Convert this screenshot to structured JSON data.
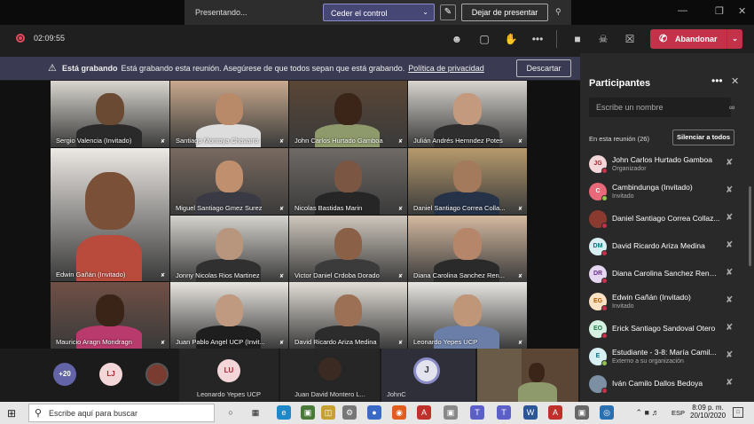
{
  "sharing_bar": {
    "status": "Presentando...",
    "give_control": "Ceder el control",
    "stop_presenting": "Dejar de presentar"
  },
  "meeting": {
    "timer": "02:09:55",
    "leave_label": "Abandonar"
  },
  "banner": {
    "title": "Está grabando",
    "message": "Está grabando esta reunión. Asegúrese de que todos sepan que está grabando.",
    "link": "Política de privacidad",
    "dismiss": "Descartar"
  },
  "tiles": [
    {
      "name": "Sergio Valencia (Invitado)",
      "bg": "#d9d6cf",
      "skin": "#6b4a33",
      "shirt": "#2a2a2a"
    },
    {
      "name": "Santiago Montoya Chavarro",
      "bg": "#c9a98e",
      "skin": "#b98a6a",
      "shirt": "#dddddd"
    },
    {
      "name": "John Carlos Hurtado Gamboa",
      "bg": "#5a4636",
      "skin": "#3b2418",
      "shirt": "#8e9a6b"
    },
    {
      "name": "Julián Andrés Hernndez Potes",
      "bg": "#d8d4cf",
      "skin": "#c49a7e",
      "shirt": "#2e2e2e"
    },
    {
      "name": "Edwin Gañán (Invitado)",
      "bg": "#ece8e4",
      "skin": "#7a5138",
      "shirt": "#b84b3b"
    },
    {
      "name": "Miguel Santiago Gmez Surez",
      "bg": "#7a6a60",
      "skin": "#c0906e",
      "shirt": "#3a3a44"
    },
    {
      "name": "Nicolas Bastidas Marin",
      "bg": "#6f6a66",
      "skin": "#7b5743",
      "shirt": "#262626"
    },
    {
      "name": "Daniel Santiago Correa Colla...",
      "bg": "#b79a6c",
      "skin": "#a37a5c",
      "shirt": "#263248"
    },
    {
      "name": "Jonny Nicolas Rios Martinez",
      "bg": "#d5d3cd",
      "skin": "#b8957d",
      "shirt": "#303030"
    },
    {
      "name": "Victor Daniel Crdoba Dorado",
      "bg": "#cfc7bd",
      "skin": "#8a6047",
      "shirt": "#3b3b3b"
    },
    {
      "name": "Diana Carolina Sanchez Ren...",
      "bg": "#d4b9a0",
      "skin": "#b5866a",
      "shirt": "#2a2a2a"
    },
    {
      "name": "Mauricio Aragn Mondragn",
      "bg": "#705046",
      "skin": "#3a2418",
      "shirt": "#b93a6c"
    },
    {
      "name": "Juan Pablo Angel UCP (Invit...",
      "bg": "#e8e5e0",
      "skin": "#c09a80",
      "shirt": "#1e1e1e"
    },
    {
      "name": "David Ricardo Ariza Medina",
      "bg": "#e2ddd6",
      "skin": "#9b7054",
      "shirt": "#2c2c2c"
    },
    {
      "name": "Leonardo Yepes UCP",
      "bg": "#e8e6e2",
      "skin": "#c09678",
      "shirt": "#6a7ea8"
    }
  ],
  "tray": {
    "overflow": "+20",
    "avatar_lj": "LJ",
    "leonardo": {
      "initials": "LU",
      "name": "Leonardo Yepes UCP"
    },
    "juan_david": {
      "name": "Juan David Montero L..."
    },
    "johnc": {
      "initials": "J",
      "name": "JohnC"
    }
  },
  "participants": {
    "title": "Participantes",
    "search_placeholder": "Escribe un nombre",
    "in_meeting": "En esta reunión (26)",
    "mute_all": "Silenciar a todos",
    "list": [
      {
        "initials": "JG",
        "name": "John Carlos Hurtado Gamboa",
        "role": "Organizador",
        "color": "#f3d6d8",
        "text": "#a4262c",
        "status": "#c4314b"
      },
      {
        "initials": "C",
        "name": "Cambindunga (Invitado)",
        "role": "Invitado",
        "color": "#e86a7a",
        "text": "#ffffff",
        "status": "#92c353"
      },
      {
        "initials": "",
        "name": "Daniel Santiago Correa Collaz...",
        "role": "",
        "color": "#8b3a2f",
        "text": "#ffffff",
        "status": "#c4314b"
      },
      {
        "initials": "DM",
        "name": "David Ricardo Ariza Medina",
        "role": "",
        "color": "#d7eef2",
        "text": "#0a6f80",
        "status": "#c4314b"
      },
      {
        "initials": "DR",
        "name": "Diana Carolina Sanchez Rengi...",
        "role": "",
        "color": "#e5d7f0",
        "text": "#6b2f8e",
        "status": "#c4314b"
      },
      {
        "initials": "EG",
        "name": "Edwin Gañán (Invitado)",
        "role": "Invitado",
        "color": "#fbe2c4",
        "text": "#b05a00",
        "status": "#c4314b"
      },
      {
        "initials": "EO",
        "name": "Erick Santiago Sandoval Otero",
        "role": "",
        "color": "#d6f0e1",
        "text": "#1e7d4a",
        "status": "#c4314b"
      },
      {
        "initials": "E",
        "name": "Estudiante - 3-8: María Camil...",
        "role": "Externo a su organización",
        "color": "#d7eef2",
        "text": "#0a6f80",
        "status": "#92c353"
      },
      {
        "initials": "",
        "name": "Iván Camilo Dallos Bedoya",
        "role": "",
        "color": "#7d8fa3",
        "text": "#ffffff",
        "status": "#c4314b"
      }
    ]
  },
  "taskbar": {
    "search": "Escribe aquí para buscar",
    "lang": "ESP",
    "time": "8:09 p. m.",
    "date": "20/10/2020"
  }
}
